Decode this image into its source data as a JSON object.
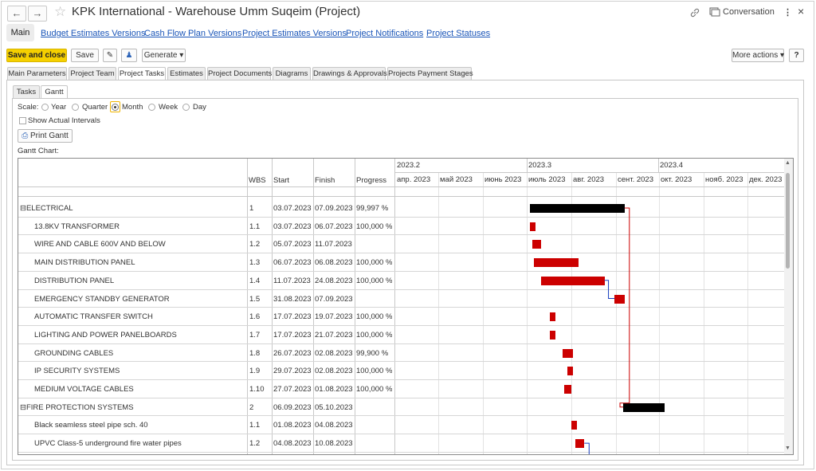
{
  "window": {
    "title": "KPK International - Warehouse Umm Suqeim (Project)",
    "back_icon": "←",
    "forward_icon": "→",
    "conversation_label": "Conversation"
  },
  "nav": {
    "main": "Main",
    "links": [
      "Budget Estimates Versions",
      "Cash Flow Plan Versions",
      "Project Estimates Versions",
      "Project Notifications",
      "Project Statuses"
    ]
  },
  "toolbar": {
    "save_close": "Save and close",
    "save": "Save",
    "generate": "Generate ▾",
    "more_actions": "More actions ▾",
    "help": "?"
  },
  "tabs": [
    "Main Parameters",
    "Project Team",
    "Project Tasks",
    "Estimates",
    "Project Documents",
    "Diagrams",
    "Drawings & Approvals",
    "Projects Payment Stages"
  ],
  "subtabs": [
    "Tasks",
    "Gantt"
  ],
  "scale": {
    "label": "Scale:",
    "options": [
      "Year",
      "Quarter",
      "Month",
      "Week",
      "Day"
    ],
    "selected": "Month"
  },
  "show_actual_intervals": "Show Actual Intervals",
  "print_gantt": "Print Gantt",
  "gantt_label": "Gantt Chart:",
  "columns": {
    "wbs": "WBS",
    "start": "Start",
    "finish": "Finish",
    "progress": "Progress"
  },
  "quarters": [
    "2023.2",
    "2023.3",
    "2023.4"
  ],
  "months": [
    "апр. 2023",
    "май 2023",
    "июнь 2023",
    "июль 2023",
    "авг. 2023",
    "сент. 2023",
    "окт. 2023",
    "нояб. 2023",
    "дек. 2023"
  ],
  "rows": [
    {
      "name": "⊟ELECTRICAL",
      "wbs": "1",
      "start": "03.07.2023",
      "finish": "07.09.2023",
      "progress": "99,997 %",
      "group": true,
      "s": [
        7,
        3
      ],
      "f": [
        9,
        7
      ]
    },
    {
      "name": "13.8KV TRANSFORMER",
      "wbs": "1.1",
      "start": "03.07.2023",
      "finish": "06.07.2023",
      "progress": "100,000 %",
      "group": false,
      "s": [
        7,
        3
      ],
      "f": [
        7,
        6
      ]
    },
    {
      "name": "WIRE AND CABLE 600V AND BELOW",
      "wbs": "1.2",
      "start": "05.07.2023",
      "finish": "11.07.2023",
      "progress": "",
      "group": false,
      "s": [
        7,
        5
      ],
      "f": [
        7,
        11
      ]
    },
    {
      "name": "MAIN DISTRIBUTION PANEL",
      "wbs": "1.3",
      "start": "06.07.2023",
      "finish": "06.08.2023",
      "progress": "100,000 %",
      "group": false,
      "s": [
        7,
        6
      ],
      "f": [
        8,
        6
      ]
    },
    {
      "name": "DISTRIBUTION PANEL",
      "wbs": "1.4",
      "start": "11.07.2023",
      "finish": "24.08.2023",
      "progress": "100,000 %",
      "group": false,
      "s": [
        7,
        11
      ],
      "f": [
        8,
        24
      ]
    },
    {
      "name": "EMERGENCY STANDBY GENERATOR",
      "wbs": "1.5",
      "start": "31.08.2023",
      "finish": "07.09.2023",
      "progress": "",
      "group": false,
      "s": [
        8,
        31
      ],
      "f": [
        9,
        7
      ]
    },
    {
      "name": "AUTOMATIC TRANSFER SWITCH",
      "wbs": "1.6",
      "start": "17.07.2023",
      "finish": "19.07.2023",
      "progress": "100,000 %",
      "group": false,
      "s": [
        7,
        17
      ],
      "f": [
        7,
        19
      ]
    },
    {
      "name": "LIGHTING AND POWER PANELBOARDS",
      "wbs": "1.7",
      "start": "17.07.2023",
      "finish": "21.07.2023",
      "progress": "100,000 %",
      "group": false,
      "s": [
        7,
        17
      ],
      "f": [
        7,
        21
      ]
    },
    {
      "name": "GROUNDING CABLES",
      "wbs": "1.8",
      "start": "26.07.2023",
      "finish": "02.08.2023",
      "progress": "99,900 %",
      "group": false,
      "s": [
        7,
        26
      ],
      "f": [
        8,
        2
      ]
    },
    {
      "name": "IP SECURITY SYSTEMS",
      "wbs": "1.9",
      "start": "29.07.2023",
      "finish": "02.08.2023",
      "progress": "100,000 %",
      "group": false,
      "s": [
        7,
        29
      ],
      "f": [
        8,
        2
      ]
    },
    {
      "name": "MEDIUM VOLTAGE CABLES",
      "wbs": "1.10",
      "start": "27.07.2023",
      "finish": "01.08.2023",
      "progress": "100,000 %",
      "group": false,
      "s": [
        7,
        27
      ],
      "f": [
        8,
        1
      ]
    },
    {
      "name": "⊟FIRE PROTECTION SYSTEMS",
      "wbs": "2",
      "start": "06.09.2023",
      "finish": "05.10.2023",
      "progress": "",
      "group": true,
      "s": [
        9,
        6
      ],
      "f": [
        10,
        5
      ]
    },
    {
      "name": "Black seamless steel pipe sch. 40",
      "wbs": "1.1",
      "start": "01.08.2023",
      "finish": "04.08.2023",
      "progress": "",
      "group": false,
      "s": [
        8,
        1
      ],
      "f": [
        8,
        4
      ]
    },
    {
      "name": "UPVC Class-5 underground fire water pipes",
      "wbs": "1.2",
      "start": "04.08.2023",
      "finish": "10.08.2023",
      "progress": "",
      "group": false,
      "s": [
        8,
        4
      ],
      "f": [
        8,
        10
      ]
    }
  ],
  "colors": {
    "accent": "#f5d000",
    "task_bar": "#cc0000",
    "summary_bar": "#000000",
    "link": "#1a55b8"
  }
}
